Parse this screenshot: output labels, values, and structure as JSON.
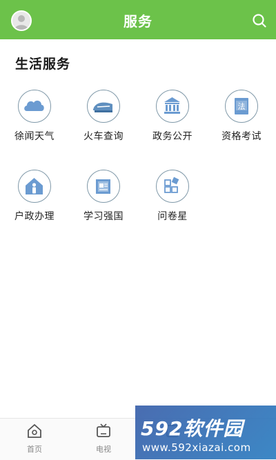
{
  "header": {
    "title": "服务",
    "background": "#6cc24a"
  },
  "section": {
    "title": "生活服务"
  },
  "services": [
    {
      "label": "徐闻天气",
      "icon": "cloud-icon"
    },
    {
      "label": "火车查询",
      "icon": "train-icon"
    },
    {
      "label": "政务公开",
      "icon": "government-building-icon"
    },
    {
      "label": "资格考试",
      "icon": "law-book-icon"
    },
    {
      "label": "户政办理",
      "icon": "house-person-icon"
    },
    {
      "label": "学习强国",
      "icon": "study-book-icon"
    },
    {
      "label": "问卷星",
      "icon": "survey-blocks-icon"
    }
  ],
  "tabs": [
    {
      "label": "首页",
      "icon": "home-icon"
    },
    {
      "label": "电视",
      "icon": "tv-icon"
    },
    {
      "label": "",
      "icon": "service-icon"
    }
  ],
  "watermark": {
    "brand": "592软件园",
    "url": "www.592xiazai.com"
  },
  "colors": {
    "accent": "#6cc24a",
    "icon_stroke": "#7f98a8",
    "icon_fill": "#6b9bd1"
  }
}
